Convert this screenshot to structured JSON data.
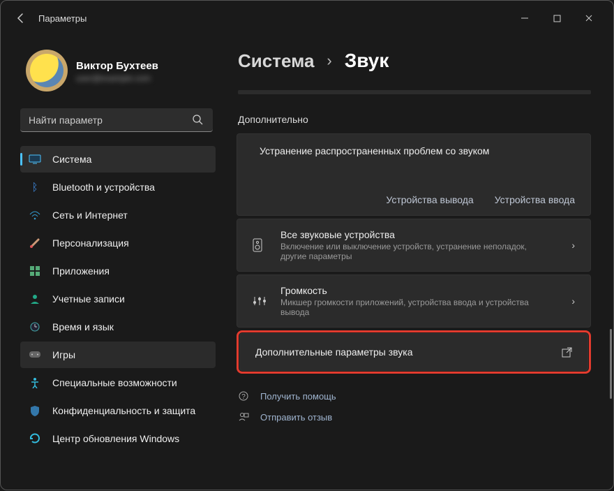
{
  "window": {
    "title": "Параметры"
  },
  "user": {
    "name": "Виктор Бухтеев",
    "email": "user@example.com"
  },
  "search": {
    "placeholder": "Найти параметр"
  },
  "sidebar": {
    "items": [
      {
        "label": "Система",
        "active": true
      },
      {
        "label": "Bluetooth и устройства"
      },
      {
        "label": "Сеть и Интернет"
      },
      {
        "label": "Персонализация"
      },
      {
        "label": "Приложения"
      },
      {
        "label": "Учетные записи"
      },
      {
        "label": "Время и язык"
      },
      {
        "label": "Игры",
        "hover": true
      },
      {
        "label": "Специальные возможности"
      },
      {
        "label": "Конфиденциальность и защита"
      },
      {
        "label": "Центр обновления Windows"
      }
    ]
  },
  "breadcrumb": {
    "parent": "Система",
    "current": "Звук"
  },
  "main": {
    "section_label": "Дополнительно",
    "troubleshoot": {
      "title": "Устранение распространенных проблем со звуком",
      "link_out": "Устройства вывода",
      "link_in": "Устройства ввода"
    },
    "rows": {
      "all_devices": {
        "title": "Все звуковые устройства",
        "sub": "Включение или выключение устройств, устранение неполадок, другие параметры"
      },
      "volume": {
        "title": "Громкость",
        "sub": "Микшер громкости приложений, устройства ввода и устройства вывода"
      },
      "more": {
        "title": "Дополнительные параметры звука"
      }
    },
    "footer": {
      "help": "Получить помощь",
      "feedback": "Отправить отзыв"
    }
  }
}
